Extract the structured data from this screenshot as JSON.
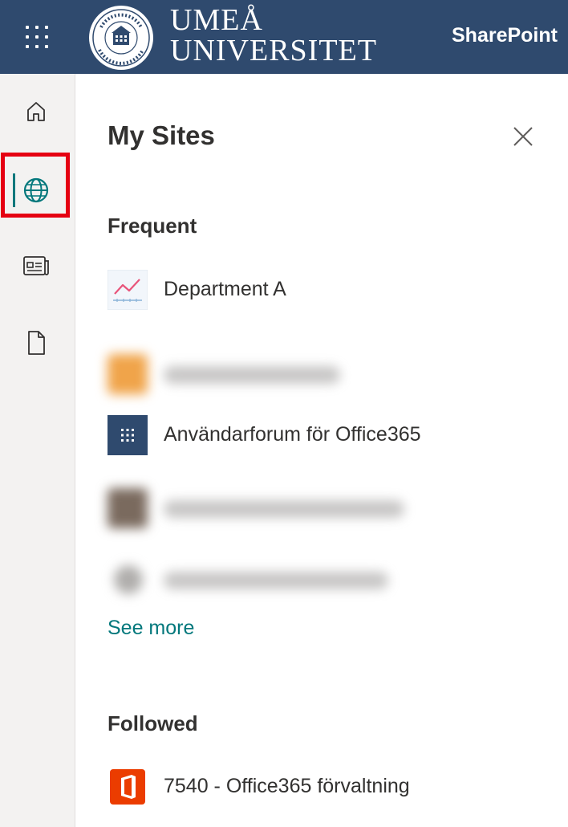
{
  "header": {
    "logo_line1": "UMEÅ",
    "logo_line2": "UNIVERSITET",
    "app_name": "SharePoint"
  },
  "rail": {
    "items": [
      {
        "name": "home",
        "icon": "home-icon"
      },
      {
        "name": "my-sites",
        "icon": "globe-icon",
        "active": true
      },
      {
        "name": "news",
        "icon": "news-icon"
      },
      {
        "name": "files",
        "icon": "document-icon"
      }
    ]
  },
  "panel": {
    "title": "My Sites",
    "frequent_heading": "Frequent",
    "frequent_items": [
      {
        "label": "Department A",
        "icon": "trend-chart-icon",
        "blurred": false
      },
      {
        "label": "",
        "icon": "site-logo-icon",
        "blurred": true
      },
      {
        "label": "Användarforum för Office365",
        "icon": "waffle-tile-icon",
        "blurred": false
      },
      {
        "label": "",
        "icon": "site-logo-icon",
        "blurred": true
      },
      {
        "label": "",
        "icon": "site-logo-icon",
        "blurred": true
      }
    ],
    "see_more": "See more",
    "followed_heading": "Followed",
    "followed_items": [
      {
        "label": "7540 - Office365 förvaltning",
        "icon": "office-logo-icon"
      }
    ]
  },
  "colors": {
    "suite_bar": "#2f4a6e",
    "accent": "#03787c",
    "highlight": "#e50012",
    "rail_bg": "#f3f2f1",
    "office_orange": "#eb3c00"
  }
}
